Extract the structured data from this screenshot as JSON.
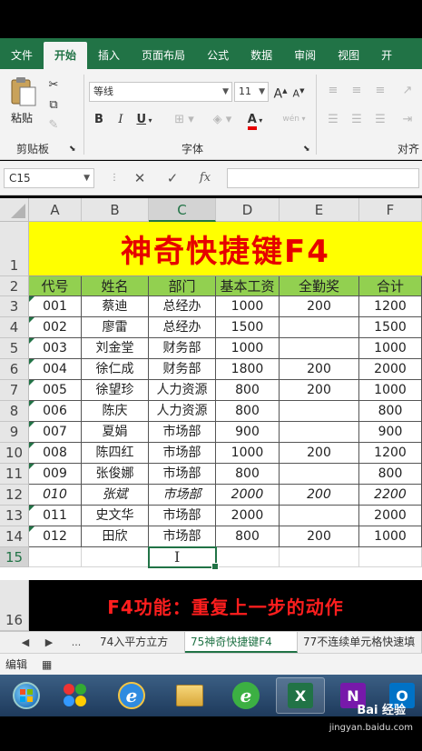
{
  "ribbon_tabs": [
    "文件",
    "开始",
    "插入",
    "页面布局",
    "公式",
    "数据",
    "审阅",
    "视图",
    "开"
  ],
  "active_tab_index": 1,
  "clipboard": {
    "paste_label": "粘贴",
    "group_label": "剪贴板"
  },
  "font": {
    "name": "等线",
    "size": "11",
    "grow": "A",
    "shrink": "A",
    "bold": "B",
    "italic": "I",
    "underline": "U",
    "font_color": "A",
    "wen": "wén",
    "group_label": "字体"
  },
  "align": {
    "group_label": "对齐"
  },
  "formula_bar": {
    "name_box": "C15",
    "cancel": "✕",
    "enter": "✓",
    "fx": "fx",
    "formula": ""
  },
  "columns": [
    "A",
    "B",
    "C",
    "D",
    "E",
    "F"
  ],
  "selected_column": "C",
  "row_numbers": [
    "1",
    "2",
    "3",
    "4",
    "5",
    "6",
    "7",
    "8",
    "9",
    "10",
    "11",
    "12",
    "13",
    "14",
    "15",
    "16"
  ],
  "selected_row": "15",
  "sheet_title": "神奇快捷键F4",
  "table_headers": [
    "代号",
    "姓名",
    "部门",
    "基本工资",
    "全勤奖",
    "合计"
  ],
  "table_rows": [
    [
      "001",
      "蔡迪",
      "总经办",
      "1000",
      "200",
      "1200"
    ],
    [
      "002",
      "廖雷",
      "总经办",
      "1500",
      "",
      "1500"
    ],
    [
      "003",
      "刘金堂",
      "财务部",
      "1000",
      "",
      "1000"
    ],
    [
      "004",
      "徐仁成",
      "财务部",
      "1800",
      "200",
      "2000"
    ],
    [
      "005",
      "徐望珍",
      "人力资源",
      "800",
      "200",
      "1000"
    ],
    [
      "006",
      "陈庆",
      "人力资源",
      "800",
      "",
      "800"
    ],
    [
      "007",
      "夏娟",
      "市场部",
      "900",
      "",
      "900"
    ],
    [
      "008",
      "陈四红",
      "市场部",
      "1000",
      "200",
      "1200"
    ],
    [
      "009",
      "张俊娜",
      "市场部",
      "800",
      "",
      "800"
    ],
    [
      "010",
      "张斌",
      "市场部",
      "2000",
      "200",
      "2200"
    ],
    [
      "011",
      "史文华",
      "市场部",
      "2000",
      "",
      "2000"
    ],
    [
      "012",
      "田欣",
      "市场部",
      "800",
      "200",
      "1000"
    ]
  ],
  "italic_row_index": 9,
  "caption": "F4功能：重复上一步的动作",
  "sheet_tabs": {
    "nav_prev": "◀",
    "nav_next": "▶",
    "ellipsis": "...",
    "tabs": [
      "74入平方立方",
      "75神奇快捷键F4",
      "77不连续单元格快速填"
    ],
    "active_index": 1
  },
  "status_bar": {
    "mode": "编辑"
  },
  "taskbar": {
    "apps": [
      "start-orb",
      "store",
      "ie",
      "explorer",
      "ie-green",
      "excel",
      "onenote",
      "outlook"
    ],
    "excel_letter": "X",
    "onenote_letter": "N",
    "outlook_letter": "O"
  },
  "watermark": {
    "text": "Bai 经验",
    "url": "jingyan.baidu.com"
  },
  "colors": {
    "excel_green": "#217346",
    "title_yellow": "#ffff00",
    "title_red": "#e60000",
    "header_green": "#92d050",
    "caption_red": "#ff1e1e"
  }
}
